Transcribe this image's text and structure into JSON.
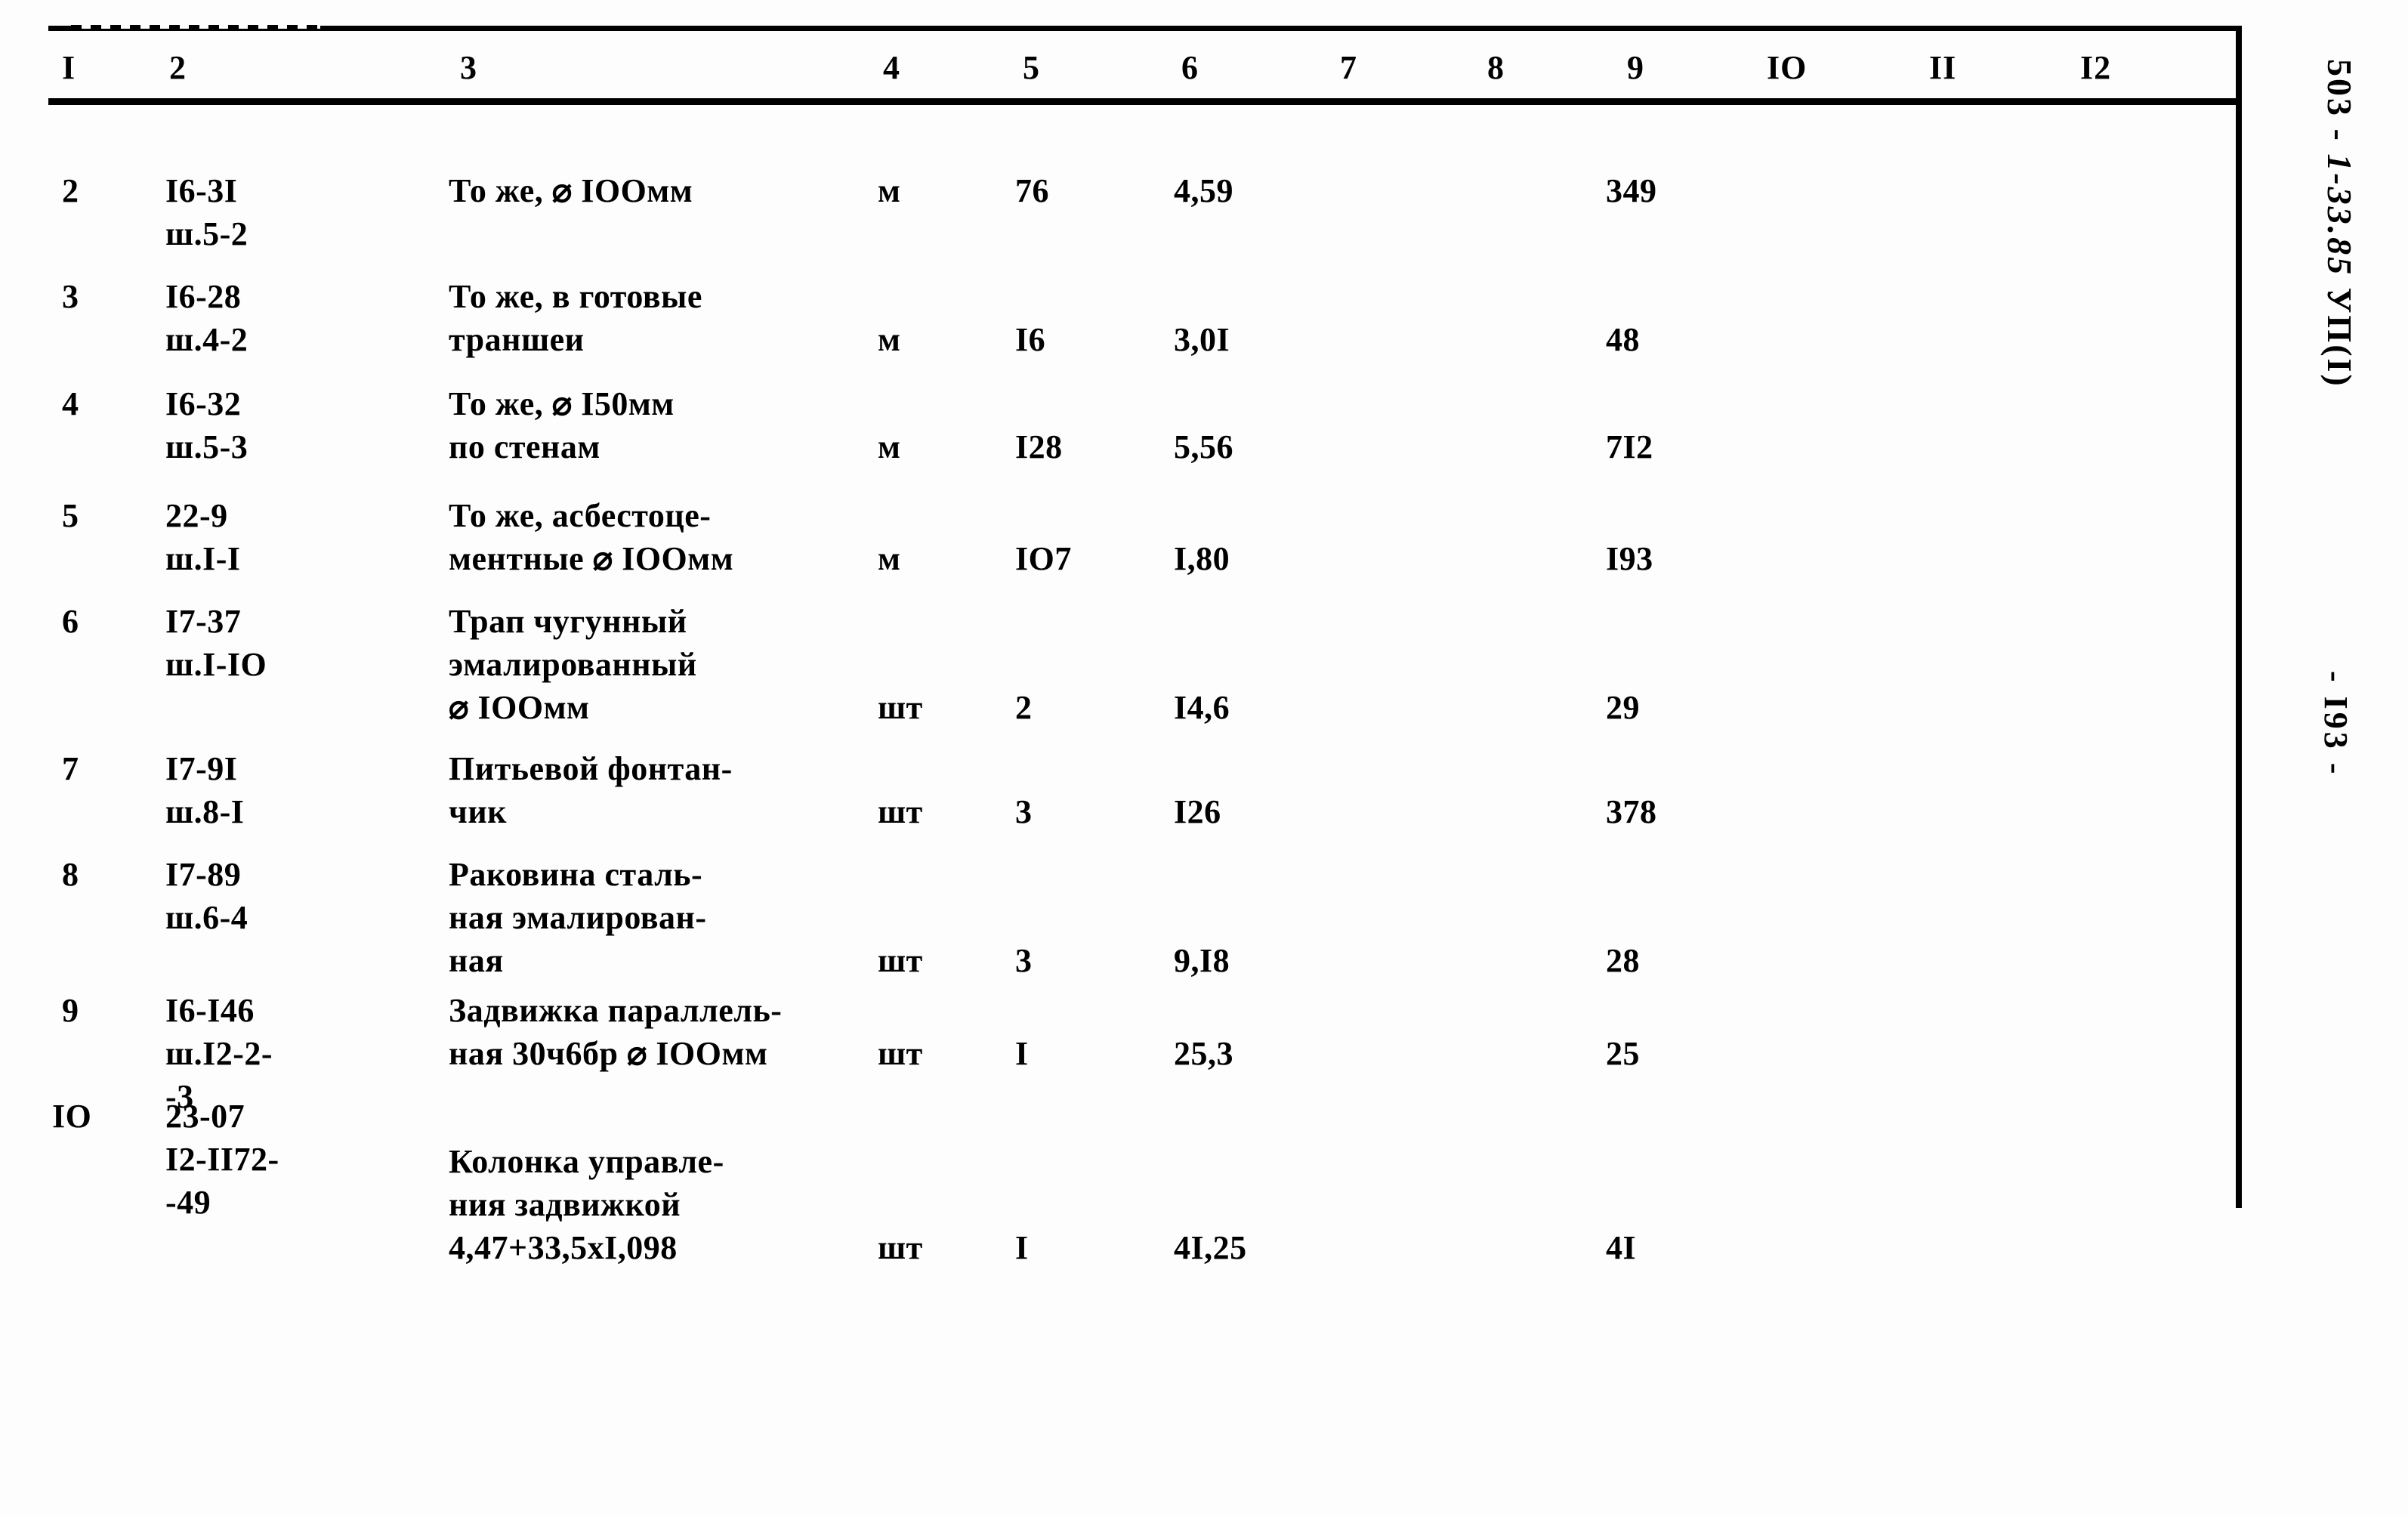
{
  "document": {
    "code_stamp": "503 - 1-33.85 УП(I)",
    "code_stamp_prefix": "503 - ",
    "code_stamp_hand": "1-33.85",
    "code_stamp_suffix": " УП(I)",
    "page_number": "- I93 -"
  },
  "table": {
    "headers": [
      "I",
      "2",
      "3",
      "4",
      "5",
      "6",
      "7",
      "8",
      "9",
      "IO",
      "II",
      "I2"
    ],
    "rows": [
      {
        "num": "2",
        "code": "I6-3I\nш.5-2",
        "desc": "То же, ⌀ IOOмм",
        "unit": "м",
        "qty": "76",
        "price": "4,59",
        "col7": "",
        "col8": "",
        "total": "349",
        "col10": "",
        "col11": "",
        "col12": ""
      },
      {
        "num": "3",
        "code": "I6-28\nш.4-2",
        "desc": "То же, в готовые\nтраншеи",
        "unit": "м",
        "qty": "I6",
        "price": "3,0I",
        "col7": "",
        "col8": "",
        "total": "48",
        "col10": "",
        "col11": "",
        "col12": ""
      },
      {
        "num": "4",
        "code": "I6-32\nш.5-3",
        "desc": "То же, ⌀ I50мм\nпо стенам",
        "unit": "м",
        "qty": "I28",
        "price": "5,56",
        "col7": "",
        "col8": "",
        "total": "7I2",
        "col10": "",
        "col11": "",
        "col12": ""
      },
      {
        "num": "5",
        "code": "22-9\nш.I-I",
        "desc": "То же, асбестоце-\nментные ⌀ IOOмм",
        "unit": "м",
        "qty": "IO7",
        "price": "I,80",
        "col7": "",
        "col8": "",
        "total": "I93",
        "col10": "",
        "col11": "",
        "col12": ""
      },
      {
        "num": "6",
        "code": "I7-37\nш.I-IO",
        "desc": "Трап чугунный\nэмалированный\n⌀ IOOмм",
        "unit": "шт",
        "qty": "2",
        "price": "I4,6",
        "col7": "",
        "col8": "",
        "total": "29",
        "col10": "",
        "col11": "",
        "col12": ""
      },
      {
        "num": "7",
        "code": "I7-9I\nш.8-I",
        "desc": "Питьевой фонтан-\nчик",
        "unit": "шт",
        "qty": "3",
        "price": "I26",
        "col7": "",
        "col8": "",
        "total": "378",
        "col10": "",
        "col11": "",
        "col12": ""
      },
      {
        "num": "8",
        "code": "I7-89\nш.6-4",
        "desc": "Раковина сталь-\nная эмалирован-\nная",
        "unit": "шт",
        "qty": "3",
        "price": "9,I8",
        "col7": "",
        "col8": "",
        "total": "28",
        "col10": "",
        "col11": "",
        "col12": ""
      },
      {
        "num": "9",
        "code": "I6-I46\nш.I2-2-\n-3",
        "desc": "Задвижка параллель-\nная 30ч6бр ⌀ IOOмм",
        "unit": "шт",
        "qty": "I",
        "price": "25,3",
        "col7": "",
        "col8": "",
        "total": "25",
        "col10": "",
        "col11": "",
        "col12": ""
      },
      {
        "num": "IO",
        "code": "23-07\nI2-II72-\n-49",
        "desc": "Колонка управле-\nния задвижкой\n4,47+33,5xI,098",
        "unit": "шт",
        "qty": "I",
        "price": "4I,25",
        "col7": "",
        "col8": "",
        "total": "4I",
        "col10": "",
        "col11": "",
        "col12": ""
      }
    ]
  }
}
